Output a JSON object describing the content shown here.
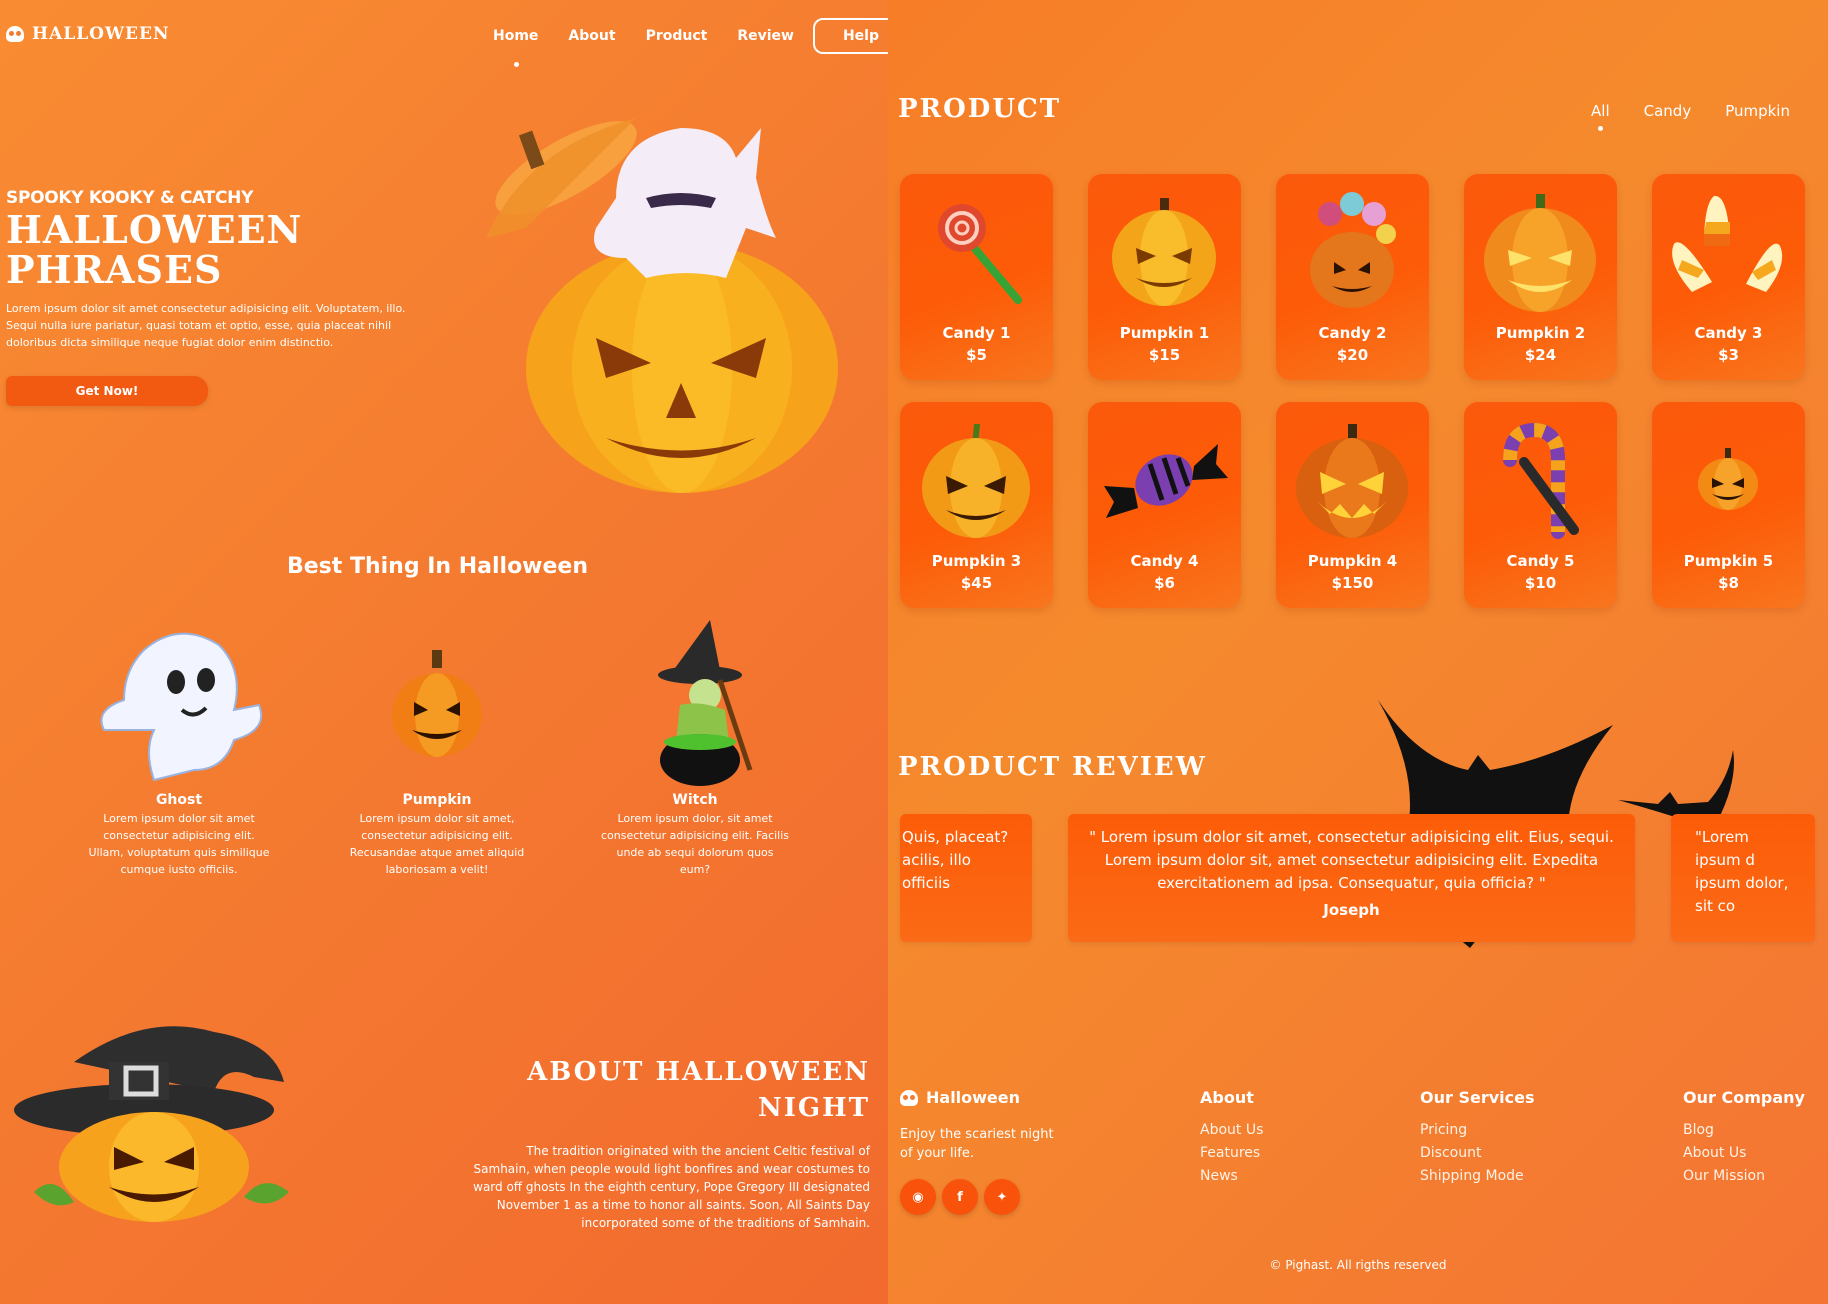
{
  "brand": {
    "logo_text": "HALLOWEEN",
    "logo_icon": "skull-icon"
  },
  "nav": {
    "items": [
      {
        "label": "Home",
        "active": true
      },
      {
        "label": "About"
      },
      {
        "label": "Product"
      },
      {
        "label": "Review"
      }
    ],
    "help_label": "Help"
  },
  "hero": {
    "subtitle": "SPOOKY KOOKY & CATCHY",
    "title": "HALLOWEEN PHRASES",
    "text": "Lorem ipsum dolor sit amet consectetur adipisicing elit. Voluptatem, illo. Sequi nulla iure pariatur, quasi totam et optio, esse, quia placeat nihil doloribus dicta similique neque fugiat dolor enim distinctio.",
    "cta_label": "Get Now!"
  },
  "best": {
    "title": "Best Thing In Halloween",
    "items": [
      {
        "name": "Ghost",
        "text": "Lorem ipsum dolor sit amet consectetur adipisicing elit. Ullam, voluptatum quis similique cumque iusto officiis.",
        "icon": "ghost-icon"
      },
      {
        "name": "Pumpkin",
        "text": "Lorem ipsum dolor sit amet, consectetur adipisicing elit. Recusandae atque amet aliquid laboriosam a velit!",
        "icon": "pumpkin-icon"
      },
      {
        "name": "Witch",
        "text": "Lorem ipsum dolor, sit amet consectetur adipisicing elit. Facilis unde ab sequi dolorum quos eum?",
        "icon": "witch-icon"
      }
    ]
  },
  "about": {
    "title": "ABOUT HALLOWEEN NIGHT",
    "text": "The tradition originated with the ancient Celtic festival of Samhain, when people would light bonfires and wear costumes to ward off ghosts In the eighth century, Pope Gregory III designated November 1 as a time to honor all saints. Soon, All Saints Day incorporated some of the traditions of Samhain."
  },
  "product": {
    "title": "PRODUCT",
    "filters": [
      {
        "label": "All",
        "active": true
      },
      {
        "label": "Candy"
      },
      {
        "label": "Pumpkin"
      }
    ],
    "items": [
      {
        "name": "Candy 1",
        "price": "$5",
        "icon": "lollipop-icon"
      },
      {
        "name": "Pumpkin 1",
        "price": "$15",
        "icon": "pumpkin-icon"
      },
      {
        "name": "Candy 2",
        "price": "$20",
        "icon": "candy-bucket-icon"
      },
      {
        "name": "Pumpkin 2",
        "price": "$24",
        "icon": "pumpkin-icon"
      },
      {
        "name": "Candy 3",
        "price": "$3",
        "icon": "candy-corn-icon"
      },
      {
        "name": "Pumpkin 3",
        "price": "$45",
        "icon": "pumpkin-icon"
      },
      {
        "name": "Candy 4",
        "price": "$6",
        "icon": "wrapped-candy-icon"
      },
      {
        "name": "Pumpkin 4",
        "price": "$150",
        "icon": "pumpkin-icon"
      },
      {
        "name": "Candy 5",
        "price": "$10",
        "icon": "candy-cane-icon"
      },
      {
        "name": "Pumpkin 5",
        "price": "$8",
        "icon": "pumpkin-icon"
      }
    ]
  },
  "review": {
    "title": "PRODUCT REVIEW",
    "left_partial": "Quis, placeat? acilis, illo officiis",
    "main": {
      "quote": "\" Lorem ipsum dolor sit amet, consectetur adipisicing elit. Eius, sequi. Lorem ipsum dolor sit, amet consectetur adipisicing elit. Expedita exercitationem ad ipsa. Consequatur, quia officia? \"",
      "author": "Joseph"
    },
    "right_partial": "\"Lorem ipsum d ipsum dolor, sit co"
  },
  "footer": {
    "brand": "Halloween",
    "desc": "Enjoy the scariest night of your life.",
    "socials": [
      "instagram-icon",
      "facebook-icon",
      "twitter-icon"
    ],
    "columns": [
      {
        "title": "About",
        "links": [
          "About Us",
          "Features",
          "News"
        ]
      },
      {
        "title": "Our Services",
        "links": [
          "Pricing",
          "Discount",
          "Shipping Mode"
        ]
      },
      {
        "title": "Our Company",
        "links": [
          "Blog",
          "About Us",
          "Our Mission"
        ]
      }
    ],
    "copyright": "© Pighast. All rigths reserved"
  }
}
